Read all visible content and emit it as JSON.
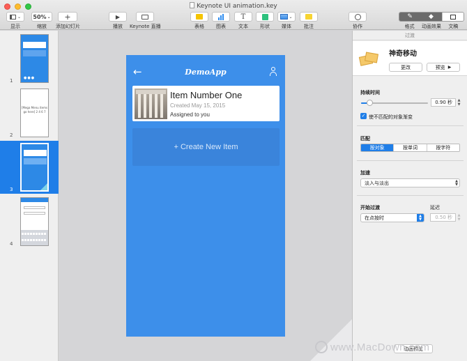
{
  "window": {
    "title": "Keynote UI animation.key"
  },
  "toolbar": {
    "view_label": "显示",
    "zoom_value": "50%",
    "zoom_label": "缩放",
    "add_slide_label": "添加幻灯片",
    "play_label": "播放",
    "keynote_live_label": "Keynote 直播",
    "table_label": "表格",
    "chart_label": "图表",
    "text_label": "文本",
    "shape_label": "形状",
    "media_label": "媒体",
    "comment_label": "批注",
    "collaborate_label": "协作",
    "format_label": "格式",
    "animate_label": "动画效果",
    "document_label": "文稿",
    "colors": {
      "table": "#f5c400",
      "chart": "#2d8cf0",
      "shape": "#2ec27e",
      "comment": "#f7d432"
    }
  },
  "navigator": {
    "slides": [
      {
        "number": "1",
        "thumb_text": ""
      },
      {
        "number": "2",
        "thumb_text": "[Mega Menu items go here] 2 4 6 7"
      },
      {
        "number": "3",
        "thumb_text": ""
      },
      {
        "number": "4",
        "thumb_text": ""
      }
    ],
    "selected_index": 2
  },
  "slide": {
    "app_title": "DemoApp",
    "back_icon": "←",
    "item_name": "Item Number One",
    "item_date": "Created May 15, 2015",
    "item_assigned": "Assigned to you",
    "create_label": "+ Create New Item"
  },
  "inspector": {
    "header": "过渡",
    "effect_name": "神奇移动",
    "change_label": "更改",
    "preview_label": "预览",
    "duration_label": "持续时间",
    "duration_value": "0.90 秒",
    "duration_fraction": 0.12,
    "fade_label": "使不匹配的对象渐变",
    "fade_checked": true,
    "match_label": "匹配",
    "match_options": [
      "按对象",
      "按单词",
      "按字符"
    ],
    "match_selected": 0,
    "accel_label": "加速",
    "accel_value": "淡入与淡出",
    "start_label": "开始过渡",
    "start_value": "在点按时",
    "delay_label": "延迟",
    "delay_value": "0.50 秒",
    "bottom_button": "动画预览"
  },
  "watermark": {
    "text": "www.MacDown.com"
  },
  "colors": {
    "accent": "#1f7ee8",
    "slide_bg": "#3d8fea"
  }
}
